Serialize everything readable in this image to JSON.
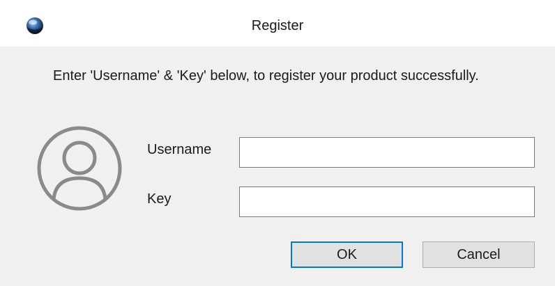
{
  "window": {
    "title": "Register",
    "icon": "app-globe-icon"
  },
  "instructions": "Enter 'Username' & 'Key' below, to register your product successfully.",
  "avatar_icon": "user-avatar-icon",
  "form": {
    "username_label": "Username",
    "username_value": "",
    "key_label": "Key",
    "key_value": ""
  },
  "buttons": {
    "ok_label": "OK",
    "cancel_label": "Cancel"
  },
  "colors": {
    "accent": "#0078d7",
    "background": "#f0f0f0",
    "titlebar": "#ffffff",
    "avatar_stroke": "#8a8a8a"
  }
}
